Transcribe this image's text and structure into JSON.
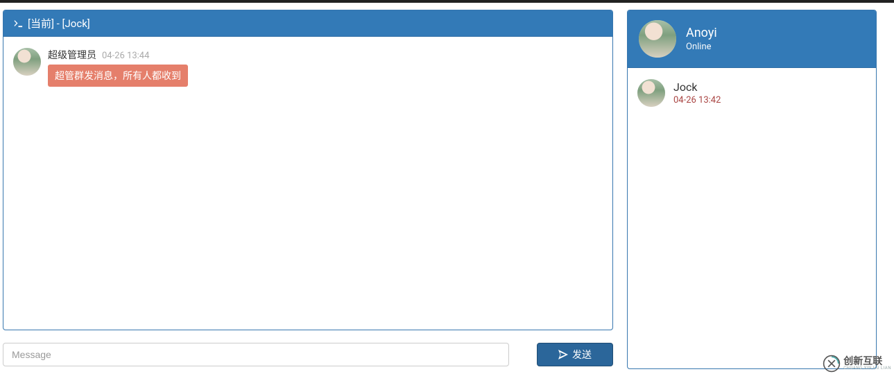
{
  "chat": {
    "header_title": "[当前] - [Jock]",
    "messages": [
      {
        "sender": "超级管理员",
        "time": "04-26 13:44",
        "text": "超管群发消息，所有人都收到"
      }
    ],
    "input_placeholder": "Message",
    "send_label": "发送"
  },
  "sidebar": {
    "username": "Anoyi",
    "status": "Online",
    "contacts": [
      {
        "name": "Jock",
        "time": "04-26 13:42"
      }
    ]
  },
  "brand": {
    "cn": "创新互联",
    "en": "CHUANG XIN HU LIAN"
  }
}
